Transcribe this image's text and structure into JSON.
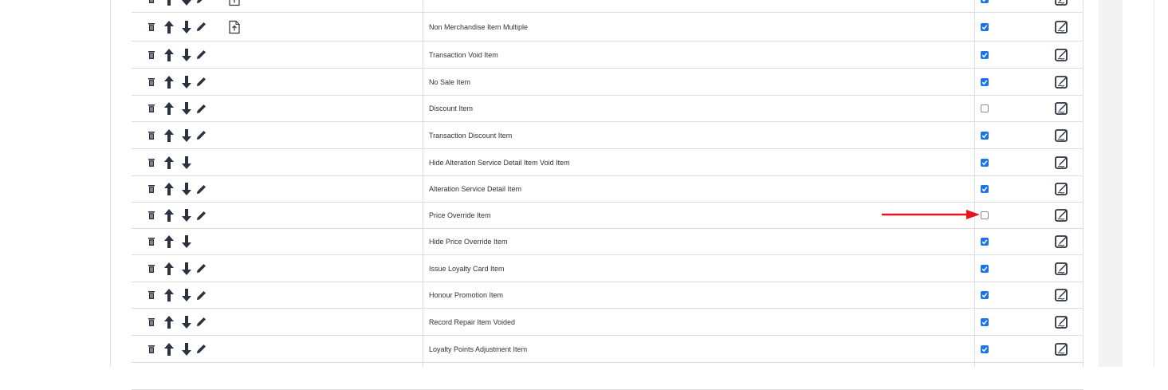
{
  "rows": [
    {
      "label": "",
      "checked": true,
      "delete": true,
      "up": true,
      "down": true,
      "edit": true,
      "doc": true
    },
    {
      "label": "Non Merchandise Item Multiple",
      "checked": true,
      "delete": true,
      "up": true,
      "down": true,
      "edit": true,
      "doc": true
    },
    {
      "label": "Transaction Void Item",
      "checked": true,
      "delete": true,
      "up": true,
      "down": true,
      "edit": true,
      "doc": false
    },
    {
      "label": "No Sale Item",
      "checked": true,
      "delete": true,
      "up": true,
      "down": true,
      "edit": true,
      "doc": false
    },
    {
      "label": "Discount Item",
      "checked": false,
      "delete": true,
      "up": true,
      "down": true,
      "edit": true,
      "doc": false
    },
    {
      "label": "Transaction Discount Item",
      "checked": true,
      "delete": true,
      "up": true,
      "down": true,
      "edit": true,
      "doc": false
    },
    {
      "label": "Hide Alteration Service Detail Item Void Item",
      "checked": true,
      "delete": true,
      "up": true,
      "down": true,
      "edit": false,
      "doc": false
    },
    {
      "label": "Alteration Service Detail Item",
      "checked": true,
      "delete": true,
      "up": true,
      "down": true,
      "edit": true,
      "doc": false
    },
    {
      "label": "Price Override Item",
      "checked": false,
      "delete": true,
      "up": true,
      "down": true,
      "edit": true,
      "doc": false
    },
    {
      "label": "Hide Price Override Item",
      "checked": true,
      "delete": true,
      "up": true,
      "down": true,
      "edit": false,
      "doc": false
    },
    {
      "label": "Issue Loyalty Card Item",
      "checked": true,
      "delete": true,
      "up": true,
      "down": true,
      "edit": true,
      "doc": false
    },
    {
      "label": "Honour Promotion Item",
      "checked": true,
      "delete": true,
      "up": true,
      "down": true,
      "edit": true,
      "doc": false
    },
    {
      "label": "Record Repair Item Voided",
      "checked": true,
      "delete": true,
      "up": true,
      "down": true,
      "edit": true,
      "doc": false
    },
    {
      "label": "Loyalty Points Adjustment Item",
      "checked": true,
      "delete": true,
      "up": true,
      "down": true,
      "edit": true,
      "doc": false
    },
    {
      "label": "",
      "checked": null,
      "delete": false,
      "up": false,
      "down": false,
      "edit": false,
      "doc": false
    }
  ],
  "annotation": {
    "arrow_color": "#e8141b",
    "points_to": "Price Override Item checkbox"
  },
  "colors": {
    "checkbox_on": "#1a73e8",
    "icon": "#2b3340",
    "text": "#333333",
    "grid": "#dedede"
  }
}
